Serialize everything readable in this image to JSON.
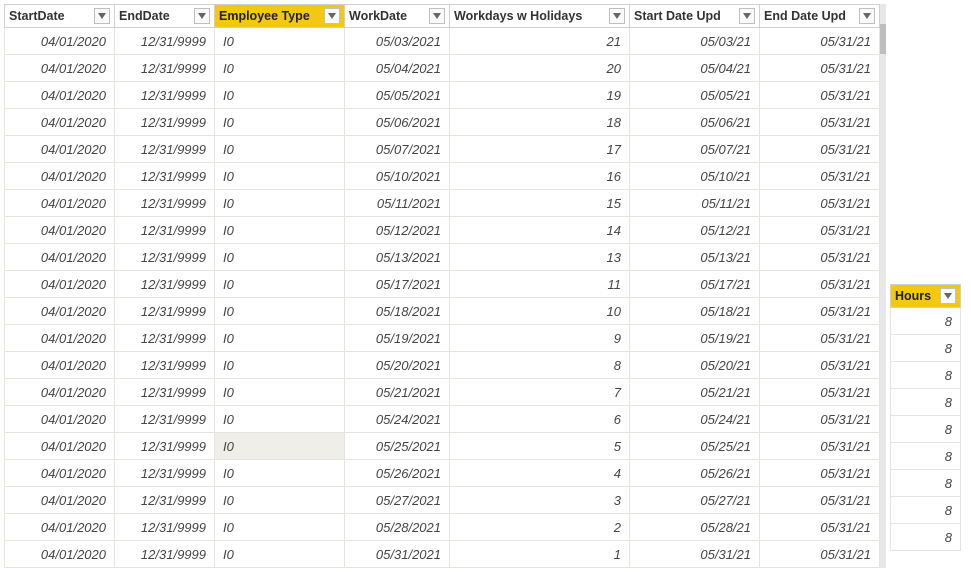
{
  "headers": {
    "startDate": "StartDate",
    "endDate": "EndDate",
    "employeeType": "Employee Type",
    "workDate": "WorkDate",
    "workdays": "Workdays w Holidays",
    "startDateUpd": "Start Date Upd",
    "endDateUpd": "End Date Upd",
    "hours": "Hours"
  },
  "selectedColumn": "employeeType",
  "highlightedCell": {
    "row": 15,
    "col": "employeeType"
  },
  "rows": [
    {
      "startDate": "04/01/2020",
      "endDate": "12/31/9999",
      "employeeType": "I0",
      "workDate": "05/03/2021",
      "workdays": 21,
      "startDateUpd": "05/03/21",
      "endDateUpd": "05/31/21"
    },
    {
      "startDate": "04/01/2020",
      "endDate": "12/31/9999",
      "employeeType": "I0",
      "workDate": "05/04/2021",
      "workdays": 20,
      "startDateUpd": "05/04/21",
      "endDateUpd": "05/31/21"
    },
    {
      "startDate": "04/01/2020",
      "endDate": "12/31/9999",
      "employeeType": "I0",
      "workDate": "05/05/2021",
      "workdays": 19,
      "startDateUpd": "05/05/21",
      "endDateUpd": "05/31/21"
    },
    {
      "startDate": "04/01/2020",
      "endDate": "12/31/9999",
      "employeeType": "I0",
      "workDate": "05/06/2021",
      "workdays": 18,
      "startDateUpd": "05/06/21",
      "endDateUpd": "05/31/21"
    },
    {
      "startDate": "04/01/2020",
      "endDate": "12/31/9999",
      "employeeType": "I0",
      "workDate": "05/07/2021",
      "workdays": 17,
      "startDateUpd": "05/07/21",
      "endDateUpd": "05/31/21"
    },
    {
      "startDate": "04/01/2020",
      "endDate": "12/31/9999",
      "employeeType": "I0",
      "workDate": "05/10/2021",
      "workdays": 16,
      "startDateUpd": "05/10/21",
      "endDateUpd": "05/31/21"
    },
    {
      "startDate": "04/01/2020",
      "endDate": "12/31/9999",
      "employeeType": "I0",
      "workDate": "05/11/2021",
      "workdays": 15,
      "startDateUpd": "05/11/21",
      "endDateUpd": "05/31/21"
    },
    {
      "startDate": "04/01/2020",
      "endDate": "12/31/9999",
      "employeeType": "I0",
      "workDate": "05/12/2021",
      "workdays": 14,
      "startDateUpd": "05/12/21",
      "endDateUpd": "05/31/21"
    },
    {
      "startDate": "04/01/2020",
      "endDate": "12/31/9999",
      "employeeType": "I0",
      "workDate": "05/13/2021",
      "workdays": 13,
      "startDateUpd": "05/13/21",
      "endDateUpd": "05/31/21"
    },
    {
      "startDate": "04/01/2020",
      "endDate": "12/31/9999",
      "employeeType": "I0",
      "workDate": "05/17/2021",
      "workdays": 11,
      "startDateUpd": "05/17/21",
      "endDateUpd": "05/31/21"
    },
    {
      "startDate": "04/01/2020",
      "endDate": "12/31/9999",
      "employeeType": "I0",
      "workDate": "05/18/2021",
      "workdays": 10,
      "startDateUpd": "05/18/21",
      "endDateUpd": "05/31/21"
    },
    {
      "startDate": "04/01/2020",
      "endDate": "12/31/9999",
      "employeeType": "I0",
      "workDate": "05/19/2021",
      "workdays": 9,
      "startDateUpd": "05/19/21",
      "endDateUpd": "05/31/21"
    },
    {
      "startDate": "04/01/2020",
      "endDate": "12/31/9999",
      "employeeType": "I0",
      "workDate": "05/20/2021",
      "workdays": 8,
      "startDateUpd": "05/20/21",
      "endDateUpd": "05/31/21"
    },
    {
      "startDate": "04/01/2020",
      "endDate": "12/31/9999",
      "employeeType": "I0",
      "workDate": "05/21/2021",
      "workdays": 7,
      "startDateUpd": "05/21/21",
      "endDateUpd": "05/31/21"
    },
    {
      "startDate": "04/01/2020",
      "endDate": "12/31/9999",
      "employeeType": "I0",
      "workDate": "05/24/2021",
      "workdays": 6,
      "startDateUpd": "05/24/21",
      "endDateUpd": "05/31/21"
    },
    {
      "startDate": "04/01/2020",
      "endDate": "12/31/9999",
      "employeeType": "I0",
      "workDate": "05/25/2021",
      "workdays": 5,
      "startDateUpd": "05/25/21",
      "endDateUpd": "05/31/21"
    },
    {
      "startDate": "04/01/2020",
      "endDate": "12/31/9999",
      "employeeType": "I0",
      "workDate": "05/26/2021",
      "workdays": 4,
      "startDateUpd": "05/26/21",
      "endDateUpd": "05/31/21"
    },
    {
      "startDate": "04/01/2020",
      "endDate": "12/31/9999",
      "employeeType": "I0",
      "workDate": "05/27/2021",
      "workdays": 3,
      "startDateUpd": "05/27/21",
      "endDateUpd": "05/31/21"
    },
    {
      "startDate": "04/01/2020",
      "endDate": "12/31/9999",
      "employeeType": "I0",
      "workDate": "05/28/2021",
      "workdays": 2,
      "startDateUpd": "05/28/21",
      "endDateUpd": "05/31/21"
    },
    {
      "startDate": "04/01/2020",
      "endDate": "12/31/9999",
      "employeeType": "I0",
      "workDate": "05/31/2021",
      "workdays": 1,
      "startDateUpd": "05/31/21",
      "endDateUpd": "05/31/21"
    }
  ],
  "hoursRows": [
    8,
    8,
    8,
    8,
    8,
    8,
    8,
    8,
    8
  ]
}
